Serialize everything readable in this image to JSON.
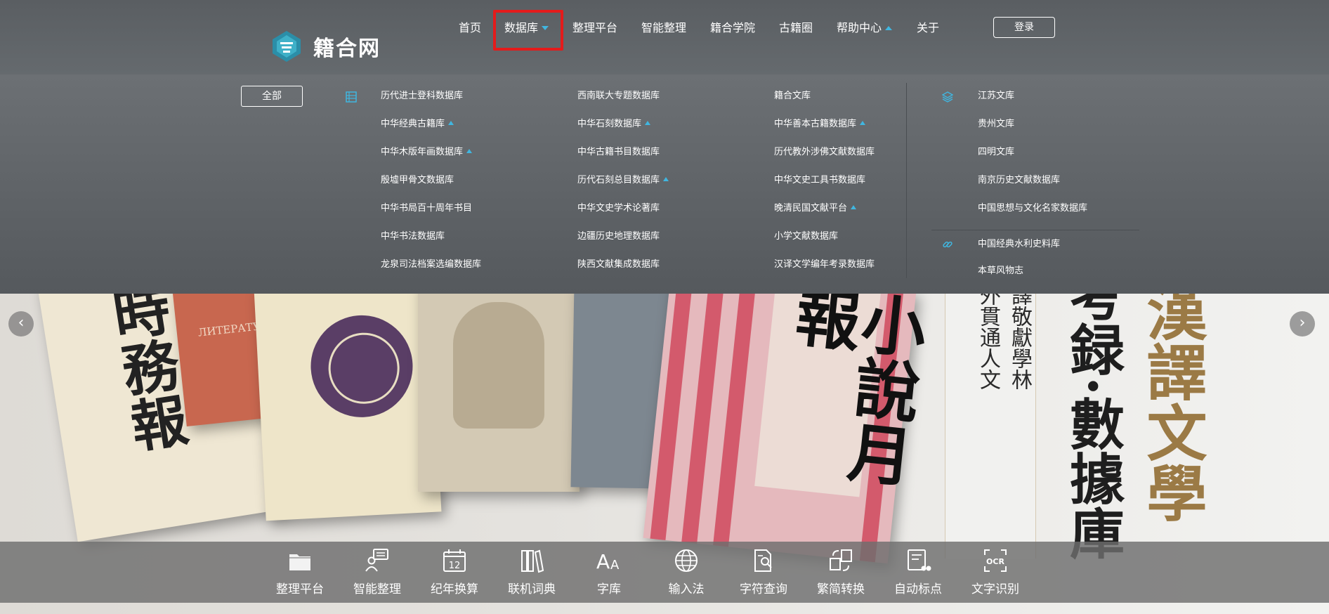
{
  "site": {
    "logo_text": "籍合网"
  },
  "nav": {
    "items": [
      {
        "label": "首页"
      },
      {
        "label": "数据库"
      },
      {
        "label": "整理平台"
      },
      {
        "label": "智能整理"
      },
      {
        "label": "籍合学院"
      },
      {
        "label": "古籍圈"
      },
      {
        "label": "帮助中心"
      },
      {
        "label": "关于"
      }
    ],
    "login_label": "登录",
    "accent_color": "#40b6e0",
    "highlight_color": "#e41b1b"
  },
  "dropdown": {
    "all_label": "全部",
    "col1": [
      "历代进士登科数据库",
      "中华经典古籍库",
      "中华木版年画数据库",
      "殷墟甲骨文数据库",
      "中华书局百十周年书目",
      "中华书法数据库",
      "龙泉司法档案选编数据库"
    ],
    "col2": [
      "西南联大专题数据库",
      "中华石刻数据库",
      "中华古籍书目数据库",
      "历代石刻总目数据库",
      "中华文史学术论著库",
      "边疆历史地理数据库",
      "陕西文献集成数据库"
    ],
    "col3": [
      "籍合文库",
      "中华善本古籍数据库",
      "历代教外涉佛文献数据库",
      "中华文史工具书数据库",
      "晚清民国文献平台",
      "小学文献数据库",
      "汉译文学编年考录数据库"
    ],
    "col4a": [
      "江苏文库",
      "贵州文库",
      "四明文库",
      "南京历史文献数据库",
      "中国思想与文化名家数据库"
    ],
    "col4b": [
      "中国经典水利史料库",
      "本草风物志"
    ]
  },
  "hero": {
    "mag_title_1": "時務報",
    "mag_title_2": "小說月報",
    "mag_red_text": "ЛИТЕРАТУ",
    "paper_col1": "外貫通人文",
    "paper_col2": "譯敬獻學林",
    "title_black": "考録·數據庫",
    "title_gold": "漢譯文學"
  },
  "tools": [
    {
      "label": "整理平台"
    },
    {
      "label": "智能整理"
    },
    {
      "label": "纪年换算"
    },
    {
      "label": "联机词典"
    },
    {
      "label": "字库"
    },
    {
      "label": "输入法"
    },
    {
      "label": "字符查询"
    },
    {
      "label": "繁简转换"
    },
    {
      "label": "自动标点"
    },
    {
      "label": "文字识别"
    }
  ],
  "tool_icon_text": {
    "calendar": "12",
    "font": "A",
    "ocr": "OCR"
  }
}
